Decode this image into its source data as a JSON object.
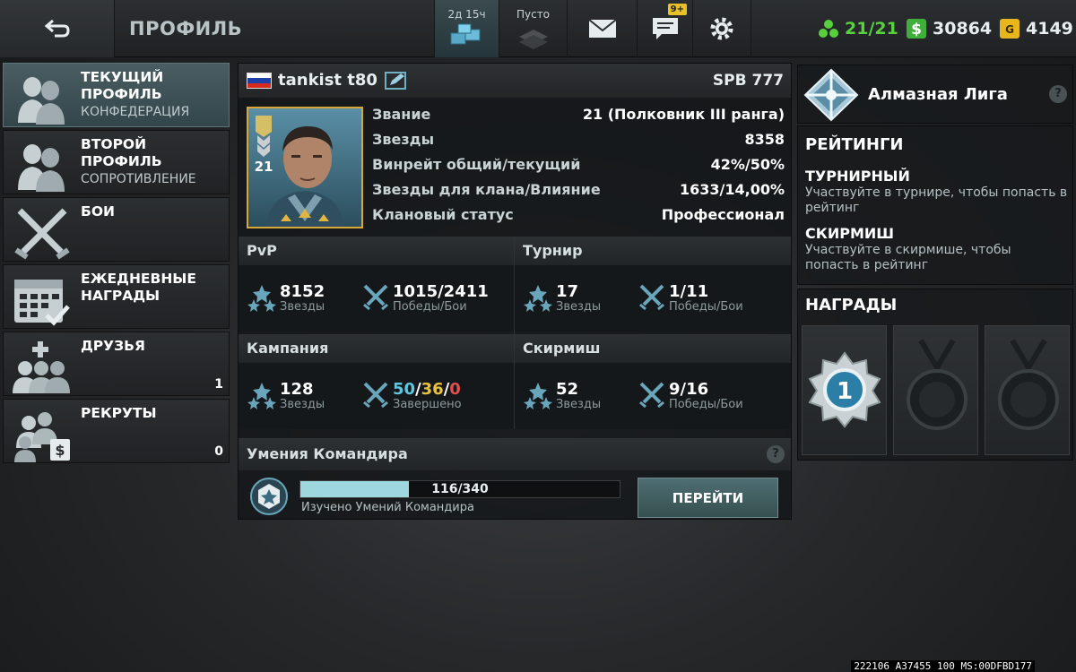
{
  "topbar": {
    "title": "ПРОФИЛЬ",
    "storage_time": "2д 15ч",
    "storage_empty": "Пусто",
    "chat_badge": "9+",
    "energy": "21/21",
    "money": "30864",
    "gold": "4149"
  },
  "menu": [
    {
      "title": "ТЕКУЩИЙ ПРОФИЛЬ",
      "sub": "КОНФЕДЕРАЦИЯ",
      "count": "",
      "icon": "soldiers-icon"
    },
    {
      "title": "ВТОРОЙ ПРОФИЛЬ",
      "sub": "СОПРОТИВЛЕНИЕ",
      "count": "",
      "icon": "soldiers-icon"
    },
    {
      "title": "БОИ",
      "sub": "",
      "count": "",
      "icon": "crossed-swords-icon"
    },
    {
      "title": "ЕЖЕДНЕВНЫЕ НАГРАДЫ",
      "sub": "",
      "count": "",
      "icon": "calendar-icon"
    },
    {
      "title": "ДРУЗЬЯ",
      "sub": "",
      "count": "1",
      "icon": "friends-icon"
    },
    {
      "title": "РЕКРУТЫ",
      "sub": "",
      "count": "0",
      "icon": "recruits-icon"
    }
  ],
  "profile": {
    "name": "tankist t80",
    "server": "SPB 777",
    "level": "21",
    "rows": [
      {
        "k": "Звание",
        "v": "21 (Полковник III ранга)"
      },
      {
        "k": "Звезды",
        "v": "8358"
      },
      {
        "k": "Винрейт общий/текущий",
        "v": "42%/50%"
      },
      {
        "k": "Звезды для клана/Влияние",
        "v": "1633/14,00%"
      },
      {
        "k": "Клановый статус",
        "v": "Профессионал"
      }
    ]
  },
  "sections": {
    "pvp": {
      "title": "PvP",
      "stars": "8152",
      "stars_label": "Звезды",
      "wins": "1015/2411",
      "wins_label": "Победы/Бои"
    },
    "tournament": {
      "title": "Турнир",
      "stars": "17",
      "stars_label": "Звезды",
      "wins": "1/11",
      "wins_label": "Победы/Бои"
    },
    "campaign": {
      "title": "Кампания",
      "stars": "128",
      "stars_label": "Звезды",
      "done_a": "50",
      "done_b": "36",
      "done_c": "0",
      "done_label": "Завершено"
    },
    "skirmish": {
      "title": "Скирмиш",
      "stars": "52",
      "stars_label": "Звезды",
      "wins": "9/16",
      "wins_label": "Победы/Бои"
    }
  },
  "skills": {
    "title": "Умения Командира",
    "progress": "116/340",
    "progress_fraction": 0.341,
    "caption": "Изучено Умений Командира",
    "button": "ПЕРЕЙТИ"
  },
  "right": {
    "league": "Алмазная Лига",
    "ratings_title": "РЕЙТИНГИ",
    "tournament_title": "ТУРНИРНЫЙ",
    "tournament_desc": "Участвуйте в турнире, чтобы попасть в рейтинг",
    "skirmish_title": "СКИРМИШ",
    "skirmish_desc": "Участвуйте в скирмише, чтобы попасть в рейтинг",
    "awards_title": "НАГРАДЫ",
    "award_value": "1"
  },
  "footer": "222106 A37455 100 MS:00DFBD177",
  "colors": {
    "accent": "#5fb8c4",
    "energy": "#57d13c",
    "money": "#3fae3a",
    "gold": "#e7b51c",
    "campaign_a": "#5fc6e0",
    "campaign_b": "#e9c23c",
    "campaign_c": "#e24d4d"
  }
}
